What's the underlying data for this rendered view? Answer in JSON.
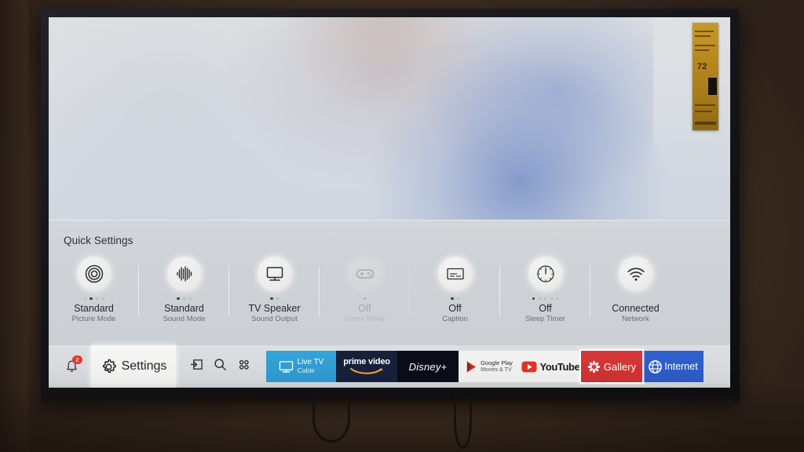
{
  "device": {
    "type": "smart-tv",
    "bezel_color": "#15161a",
    "wall_color": "#4a3728"
  },
  "sticker": {
    "label": "energy-rating-sticker",
    "value": "72"
  },
  "quick_settings": {
    "title": "Quick Settings",
    "items": [
      {
        "icon": "picture-mode-icon",
        "value": "Standard",
        "label": "Picture Mode",
        "dots": 4,
        "active_dot": 1,
        "disabled": false
      },
      {
        "icon": "sound-mode-icon",
        "value": "Standard",
        "label": "Sound Mode",
        "dots": 3,
        "active_dot": 0,
        "disabled": false
      },
      {
        "icon": "sound-output-icon",
        "value": "TV Speaker",
        "label": "Sound Output",
        "dots": 2,
        "active_dot": 0,
        "disabled": false
      },
      {
        "icon": "game-mode-icon",
        "value": "Off",
        "label": "Game Mode",
        "dots": 1,
        "active_dot": 0,
        "disabled": true
      },
      {
        "icon": "caption-icon",
        "value": "Off",
        "label": "Caption",
        "dots": 2,
        "active_dot": 0,
        "disabled": false
      },
      {
        "icon": "sleep-timer-icon",
        "value": "Off",
        "label": "Sleep Timer",
        "dots": 5,
        "active_dot": 0,
        "disabled": false
      },
      {
        "icon": "network-wifi-icon",
        "value": "Connected",
        "label": "Network",
        "dots": 0,
        "active_dot": -1,
        "disabled": false
      }
    ]
  },
  "bar": {
    "notifications": {
      "icon": "bell-icon",
      "badge_count": "2"
    },
    "settings": {
      "icon": "gear-icon",
      "label": "Settings",
      "selected": true
    },
    "quick_icons": [
      {
        "name": "source-input-icon"
      },
      {
        "name": "search-icon"
      },
      {
        "name": "apps-grid-icon"
      }
    ],
    "apps": [
      {
        "name": "live-tv",
        "title": "Live TV",
        "subtitle": "Cable",
        "color": "#2e95cb",
        "icon": "tv-icon"
      },
      {
        "name": "prime-video",
        "title": "prime video",
        "subtitle": "",
        "color": "#17203a",
        "icon": "prime-smile-icon"
      },
      {
        "name": "disney-plus",
        "title": "Disney+",
        "subtitle": "",
        "color": "#0a0c18",
        "icon": "disney-wordmark-icon"
      },
      {
        "name": "google-play-movies",
        "title": "Google Play",
        "subtitle": "Movies & TV",
        "color": "#f2f2f1",
        "icon": "play-triangle-icon"
      },
      {
        "name": "youtube",
        "title": "YouTube",
        "subtitle": "",
        "color": "#f2f2f1",
        "icon": "youtube-play-icon"
      },
      {
        "name": "gallery",
        "title": "Gallery",
        "subtitle": "",
        "color": "#c8302f",
        "icon": "gallery-flower-icon"
      },
      {
        "name": "internet",
        "title": "Internet",
        "subtitle": "",
        "color": "#2b58bf",
        "icon": "globe-icon"
      }
    ]
  }
}
